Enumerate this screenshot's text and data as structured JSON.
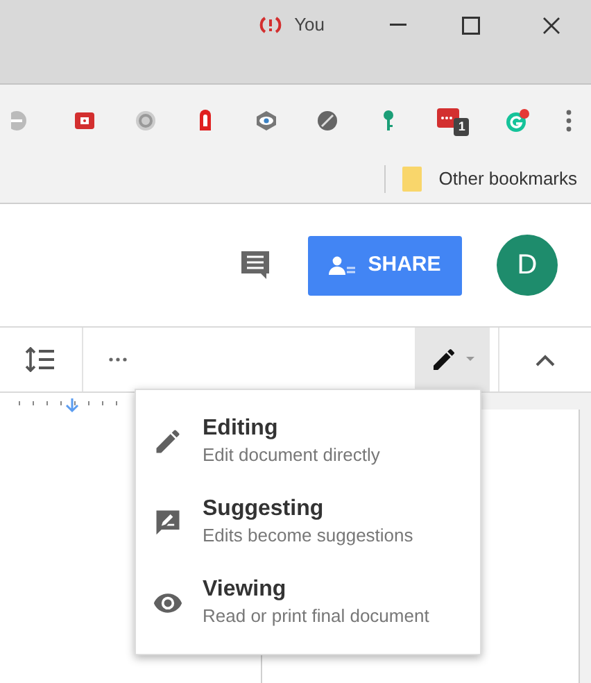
{
  "window": {
    "profile_name": "You"
  },
  "extensions": {
    "badge": "1"
  },
  "bookmarks_bar": {
    "items": [
      "Other bookmarks"
    ]
  },
  "docs_header": {
    "share_button": "SHARE",
    "avatar_initial": "D"
  },
  "mode_menu": {
    "items": [
      {
        "kind": "editing",
        "title": "Editing",
        "description": "Edit document directly"
      },
      {
        "kind": "suggesting",
        "title": "Suggesting",
        "description": "Edits become suggestions"
      },
      {
        "kind": "viewing",
        "title": "Viewing",
        "description": "Read or print final document"
      }
    ]
  }
}
